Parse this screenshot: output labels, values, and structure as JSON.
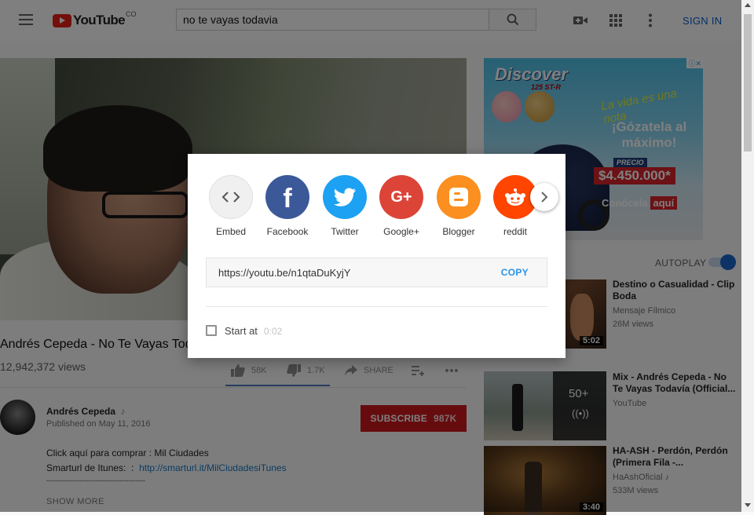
{
  "header": {
    "logo_text": "YouTube",
    "logo_country": "CO",
    "search_value": "no te vayas todavia",
    "sign_in": "SIGN IN"
  },
  "video": {
    "title": "Andrés Cepeda - No Te Vayas Todavía",
    "views": "12,942,372 views",
    "likes": "58K",
    "dislikes": "1.7K",
    "share_label": "SHARE"
  },
  "channel": {
    "name": "Andrés Cepeda",
    "music_note": "♪",
    "published": "Published on May 11, 2016",
    "subscribe_label": "SUBSCRIBE",
    "subscriber_count": "987K"
  },
  "description": {
    "line1": "Click aquí para comprar : Mil Ciudades",
    "line2_prefix": "Smarturl de Itunes:  :  ",
    "line2_link": "http://smarturl.it/MilCiudadesiTunes",
    "line3": "------------------------------------------",
    "show_more": "SHOW MORE"
  },
  "ad": {
    "brand": "Discover",
    "model": "125 ST-R",
    "slogan1": "La vida es una nota",
    "slogan2": "¡Gózatela al máximo!",
    "precio_label": "PRECIO",
    "price": "$4.450.000*",
    "cta": "Conócela",
    "cta_highlight": "aquí"
  },
  "sidebar": {
    "autoplay_label": "AUTOPLAY",
    "autoplay_on": true,
    "related": [
      {
        "title": "Destino o Casualidad - Clip Boda",
        "channel": "Mensaje Fílmico",
        "views": "26M views",
        "duration": "5:02",
        "badge": ""
      },
      {
        "title": "Mix - Andrés Cepeda - No Te Vayas Todavía (Official...",
        "channel": "YouTube",
        "views": "",
        "duration": "",
        "badge": "50+"
      },
      {
        "title": "HA-ASH - Perdón, Perdón (Primera Fila -...",
        "channel": "HaAshOficial",
        "views": "533M views",
        "duration": "3:40",
        "badge": ""
      }
    ]
  },
  "share_dialog": {
    "targets": [
      {
        "label": "Embed",
        "icon": "embed-icon",
        "color": "#f0f0f0"
      },
      {
        "label": "Facebook",
        "icon": "facebook-icon",
        "color": "#3b5998"
      },
      {
        "label": "Twitter",
        "icon": "twitter-icon",
        "color": "#1da1f2"
      },
      {
        "label": "Google+",
        "icon": "google-plus-icon",
        "color": "#db4437"
      },
      {
        "label": "Blogger",
        "icon": "blogger-icon",
        "color": "#fb8f1f"
      },
      {
        "label": "reddit",
        "icon": "reddit-icon",
        "color": "#ff4500"
      }
    ],
    "url": "https://youtu.be/n1qtaDuKyjY",
    "copy_label": "COPY",
    "start_at_label": "Start at",
    "start_time": "0:02",
    "start_checked": false
  }
}
